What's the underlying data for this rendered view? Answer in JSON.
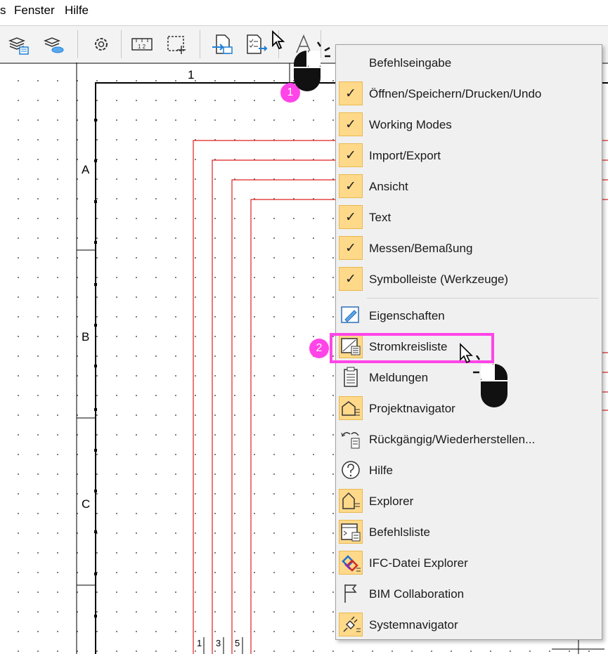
{
  "menubar": {
    "items": [
      {
        "label": "s"
      },
      {
        "label": "Fenster"
      },
      {
        "label": "Hilfe"
      }
    ]
  },
  "drawing": {
    "column_label": "1",
    "row_labels": [
      "A",
      "B",
      "C"
    ],
    "bottom_labels": [
      "1",
      "3",
      "5"
    ]
  },
  "menu": {
    "items": [
      {
        "label": "Befehlseingabe",
        "checked": false,
        "icon": "none"
      },
      {
        "label": "Öffnen/Speichern/Drucken/Undo",
        "checked": true,
        "check_glyph": "✓"
      },
      {
        "label": "Working Modes",
        "checked": true,
        "check_glyph": "✓"
      },
      {
        "label": "Import/Export",
        "checked": true,
        "check_glyph": "✓"
      },
      {
        "label": "Ansicht",
        "checked": true,
        "check_glyph": "✓"
      },
      {
        "label": "Text",
        "checked": true,
        "check_glyph": "✓"
      },
      {
        "label": "Messen/Bemaßung",
        "checked": true,
        "check_glyph": "✓"
      },
      {
        "label": "Symbolleiste (Werkzeuge)",
        "checked": true,
        "check_glyph": "✓"
      },
      {
        "label": "Eigenschaften",
        "icon": "properties-icon",
        "active": false
      },
      {
        "label": "Stromkreisliste",
        "icon": "circuit-list-icon",
        "active": true
      },
      {
        "label": "Meldungen",
        "icon": "clipboard-icon",
        "active": false
      },
      {
        "label": "Projektnavigator",
        "icon": "project-navigator-icon",
        "active": true
      },
      {
        "label": "Rückgängig/Wiederherstellen...",
        "icon": "undo-redo-icon",
        "active": false
      },
      {
        "label": "Hilfe",
        "icon": "help-icon",
        "active": false
      },
      {
        "label": "Explorer",
        "icon": "explorer-icon",
        "active": true
      },
      {
        "label": "Befehlsliste",
        "icon": "command-list-icon",
        "active": true
      },
      {
        "label": "IFC-Datei Explorer",
        "icon": "ifc-explorer-icon",
        "active": true
      },
      {
        "label": "BIM Collaboration",
        "icon": "flag-icon",
        "active": false
      },
      {
        "label": "Systemnavigator",
        "icon": "plug-icon",
        "active": true
      }
    ]
  },
  "annotations": {
    "step1": "1",
    "step2": "2"
  },
  "colors": {
    "highlight": "#ff44e8",
    "active_icon_bg": "#ffd98a",
    "wire_red": "#e02020"
  }
}
